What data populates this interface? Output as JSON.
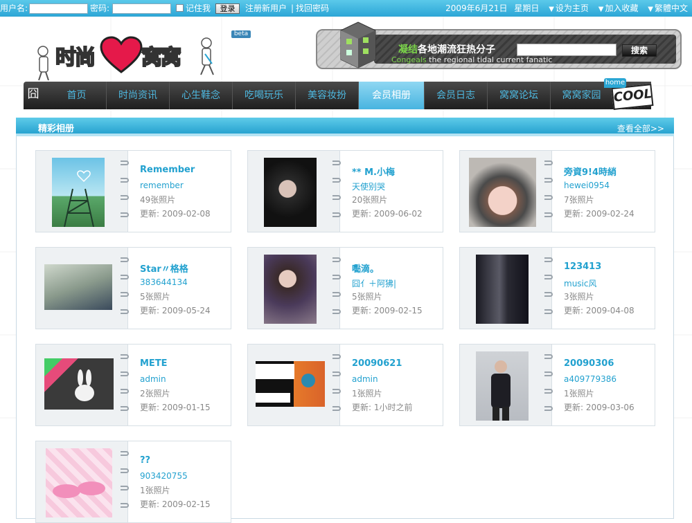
{
  "topbar": {
    "username_label": "用户名:",
    "password_label": "密码:",
    "remember_label": "记住我",
    "login_label": "登录",
    "register_link": "注册新用户",
    "separator": "|",
    "recover_link": "找回密码",
    "date": "2009年6月21日",
    "weekday": "星期日",
    "set_home": "设为主页",
    "bookmark": "加入收藏",
    "trad_chinese": "繁體中文"
  },
  "header": {
    "logo_text_left": "时尚",
    "logo_text_right": "窝窝",
    "beta": "beta",
    "banner_title_highlight": "凝结",
    "banner_title": "各地潮流狂热分子",
    "banner_sub_highlight": "Congeals",
    "banner_sub": "the regional tidal current fanatic",
    "search_button": "搜索",
    "search_value": ""
  },
  "nav": {
    "items": [
      "首页",
      "时尚资讯",
      "心生鞋念",
      "吃喝玩乐",
      "美容妆扮",
      "会员相册",
      "会员日志",
      "窝窝论坛",
      "窝窝家园"
    ],
    "active_index": 5,
    "home_tag": "home",
    "cool": "COOL"
  },
  "panel": {
    "title": "精彩相册",
    "more": "查看全部>>"
  },
  "albums": [
    {
      "title": "Remember",
      "owner": "remember",
      "count": "49张照片",
      "updated": "更新: 2009-02-08"
    },
    {
      "title": "** M.小梅",
      "owner": "天使别哭",
      "count": "20张照片",
      "updated": "更新: 2009-06-02"
    },
    {
      "title": "旁資9!4時綃",
      "owner": "hewei0954",
      "count": "7张照片",
      "updated": "更新: 2009-02-24"
    },
    {
      "title": "Star〃格格",
      "owner": "383644134",
      "count": "5张照片",
      "updated": "更新: 2009-05-24"
    },
    {
      "title": "嚸滴。",
      "owner": "囧亻＋阿狒|",
      "count": "5张照片",
      "updated": "更新: 2009-02-15"
    },
    {
      "title": "123413",
      "owner": "music风",
      "count": "3张照片",
      "updated": "更新: 2009-04-08"
    },
    {
      "title": "METE",
      "owner": "admin",
      "count": "2张照片",
      "updated": "更新: 2009-01-15"
    },
    {
      "title": "20090621",
      "owner": "admin",
      "count": "1张照片",
      "updated": "更新: 1小时之前"
    },
    {
      "title": "20090306",
      "owner": "a409779386",
      "count": "1张照片",
      "updated": "更新: 2009-03-06"
    },
    {
      "title": "??",
      "owner": "903420755",
      "count": "1张照片",
      "updated": "更新: 2009-02-15"
    }
  ],
  "colors": {
    "accent": "#22a1cf",
    "topbar": "#3bb3e0",
    "nav_bg": "#2a2a2a"
  }
}
